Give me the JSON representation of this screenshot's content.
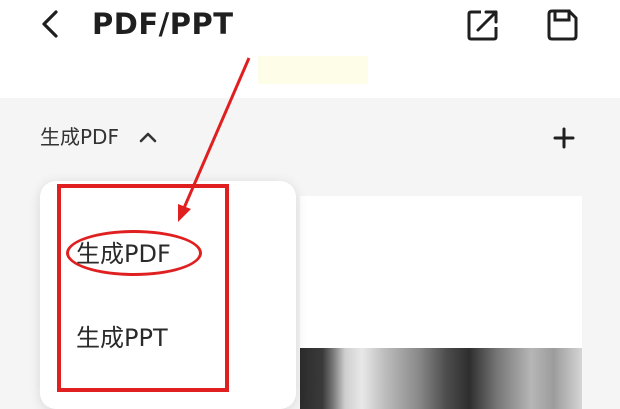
{
  "header": {
    "title": "PDF/PPT",
    "icons": {
      "back": "chevron-left-icon",
      "share": "external-link-icon",
      "save": "floppy-disk-icon"
    }
  },
  "section": {
    "label": "生成PDF",
    "toggle_icon": "chevron-up-icon",
    "add_icon": "plus-icon"
  },
  "dropdown": {
    "items": [
      {
        "label": "生成PDF"
      },
      {
        "label": "生成PPT"
      }
    ]
  },
  "colors": {
    "annotation": "#e02020",
    "content_background": "#f5f5f5",
    "highlight": "#fdfde8"
  }
}
